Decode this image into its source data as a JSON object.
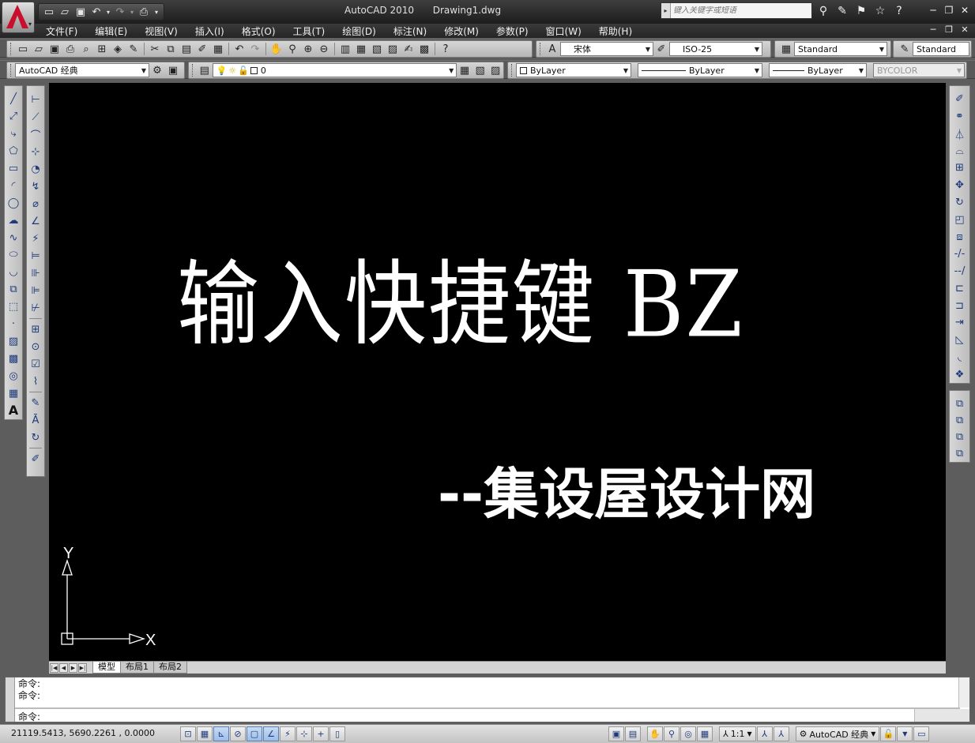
{
  "app": {
    "title": "AutoCAD 2010",
    "document": "Drawing1.dwg",
    "search_placeholder": "键入关键字或短语"
  },
  "menu": [
    "文件(F)",
    "编辑(E)",
    "视图(V)",
    "插入(I)",
    "格式(O)",
    "工具(T)",
    "绘图(D)",
    "标注(N)",
    "修改(M)",
    "参数(P)",
    "窗口(W)",
    "帮助(H)"
  ],
  "styles": {
    "font": "宋体",
    "dim_style": "ISO-25",
    "table_style": "Standard",
    "multileader_style": "Standard"
  },
  "workspace": {
    "name": "AutoCAD 经典"
  },
  "layers": {
    "current": "0"
  },
  "properties": {
    "color": "ByLayer",
    "linetype": "ByLayer",
    "lineweight": "ByLayer",
    "plot_style": "BYCOLOR"
  },
  "canvas": {
    "background": "#000000",
    "main_text": "输入快捷键 BZ",
    "watermark": "--集设屋设计网",
    "ucs_x": "X",
    "ucs_y": "Y"
  },
  "layout_tabs": [
    "模型",
    "布局1",
    "布局2"
  ],
  "command": {
    "history": [
      "命令:",
      "命令:"
    ],
    "prompt": "命令:"
  },
  "status": {
    "coordinates": "21119.5413, 5690.2261 , 0.0000",
    "annotation_scale": "1:1",
    "workspace": "AutoCAD 经典"
  },
  "icons": {
    "qat": [
      "new-icon",
      "open-icon",
      "save-icon",
      "undo-icon",
      "redo-icon",
      "plot-icon"
    ],
    "info": [
      "binoculars-icon",
      "communication-center-icon",
      "favorites-icon",
      "help-icon"
    ],
    "draw": [
      "line-icon",
      "construction-line-icon",
      "polyline-icon",
      "polygon-icon",
      "rectangle-icon",
      "arc-icon",
      "circle-icon",
      "revision-cloud-icon",
      "spline-icon",
      "ellipse-icon",
      "ellipse-arc-icon",
      "insert-block-icon",
      "make-block-icon",
      "point-icon",
      "hatch-icon",
      "gradient-icon",
      "region-icon",
      "table-icon",
      "multiline-text-icon"
    ],
    "dimension": [
      "linear-dim-icon",
      "aligned-dim-icon",
      "arc-length-icon",
      "ordinate-icon",
      "radius-icon",
      "jogged-icon",
      "diameter-icon",
      "angular-icon",
      "quick-dim-icon",
      "baseline-icon",
      "continue-icon",
      "dim-space-icon",
      "dim-break-icon",
      "tolerance-icon",
      "center-mark-icon",
      "inspection-icon",
      "jogged-linear-icon",
      "dim-edit-icon",
      "dim-text-edit-icon",
      "dim-update-icon",
      "dim-style-icon"
    ],
    "modify": [
      "erase-icon",
      "copy-icon",
      "mirror-icon",
      "offset-icon",
      "array-icon",
      "move-icon",
      "rotate-icon",
      "scale-icon",
      "stretch-icon",
      "trim-icon",
      "extend-icon",
      "break-at-point-icon",
      "break-icon",
      "join-icon",
      "chamfer-icon",
      "fillet-icon",
      "explode-icon"
    ],
    "draw_order": [
      "bring-to-front-icon",
      "send-to-back-icon",
      "bring-above-icon",
      "send-under-icon"
    ]
  },
  "colors": {
    "chrome_dark": "#2a2a2a",
    "toolbar_gray": "#c8c8c8",
    "canvas": "#000000",
    "text": "#ffffff"
  }
}
